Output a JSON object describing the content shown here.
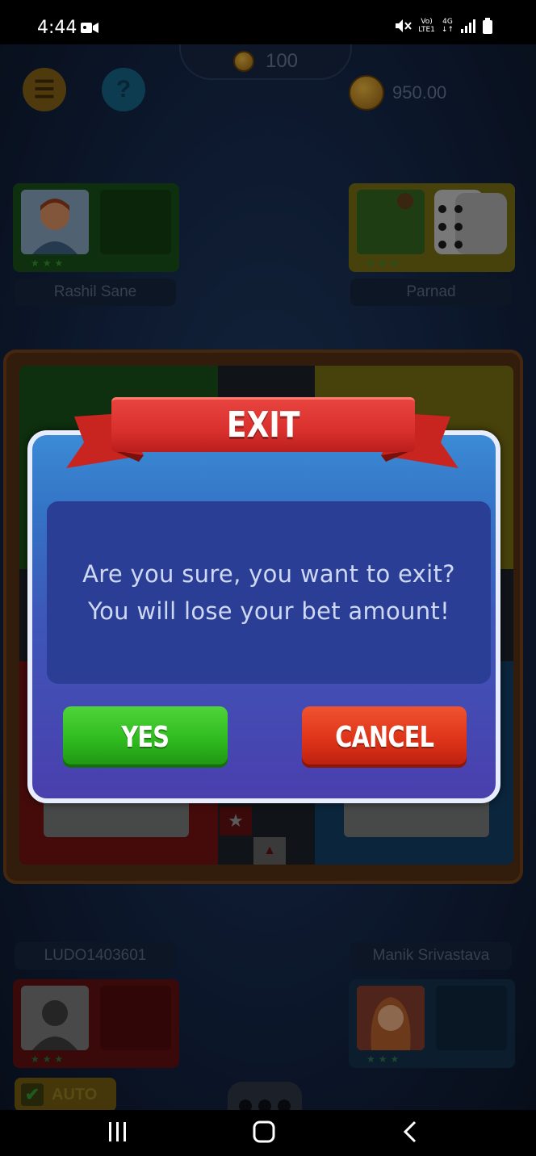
{
  "status_bar": {
    "time": "4:44",
    "network_label_top": "Vo)",
    "network_label_bottom": "LTE1",
    "data_label_top": "4G",
    "data_label_bottom": "↓↑"
  },
  "header": {
    "bet_amount": "100",
    "wallet_balance": "950.00"
  },
  "players": {
    "top_left": {
      "name": "Rashil Sane",
      "color": "#1c5a1c"
    },
    "top_right": {
      "name": "Parnad",
      "color": "#7a7010"
    },
    "bottom_left": {
      "name": "LUDO1403601",
      "color": "#6a1212"
    },
    "bottom_right": {
      "name": "Manik Srivastava",
      "color": "#153a5a"
    }
  },
  "auto_button": {
    "label": "AUTO"
  },
  "dialog": {
    "title": "EXIT",
    "message_line1": "Are you sure, you want to exit?",
    "message_line2": "You will lose your bet amount!",
    "yes_label": "YES",
    "cancel_label": "CANCEL"
  },
  "colors": {
    "yes_green": "#2fbb1f",
    "cancel_red": "#de3319",
    "ribbon_red": "#d9302d",
    "dialog_blue": "#3474c6"
  }
}
